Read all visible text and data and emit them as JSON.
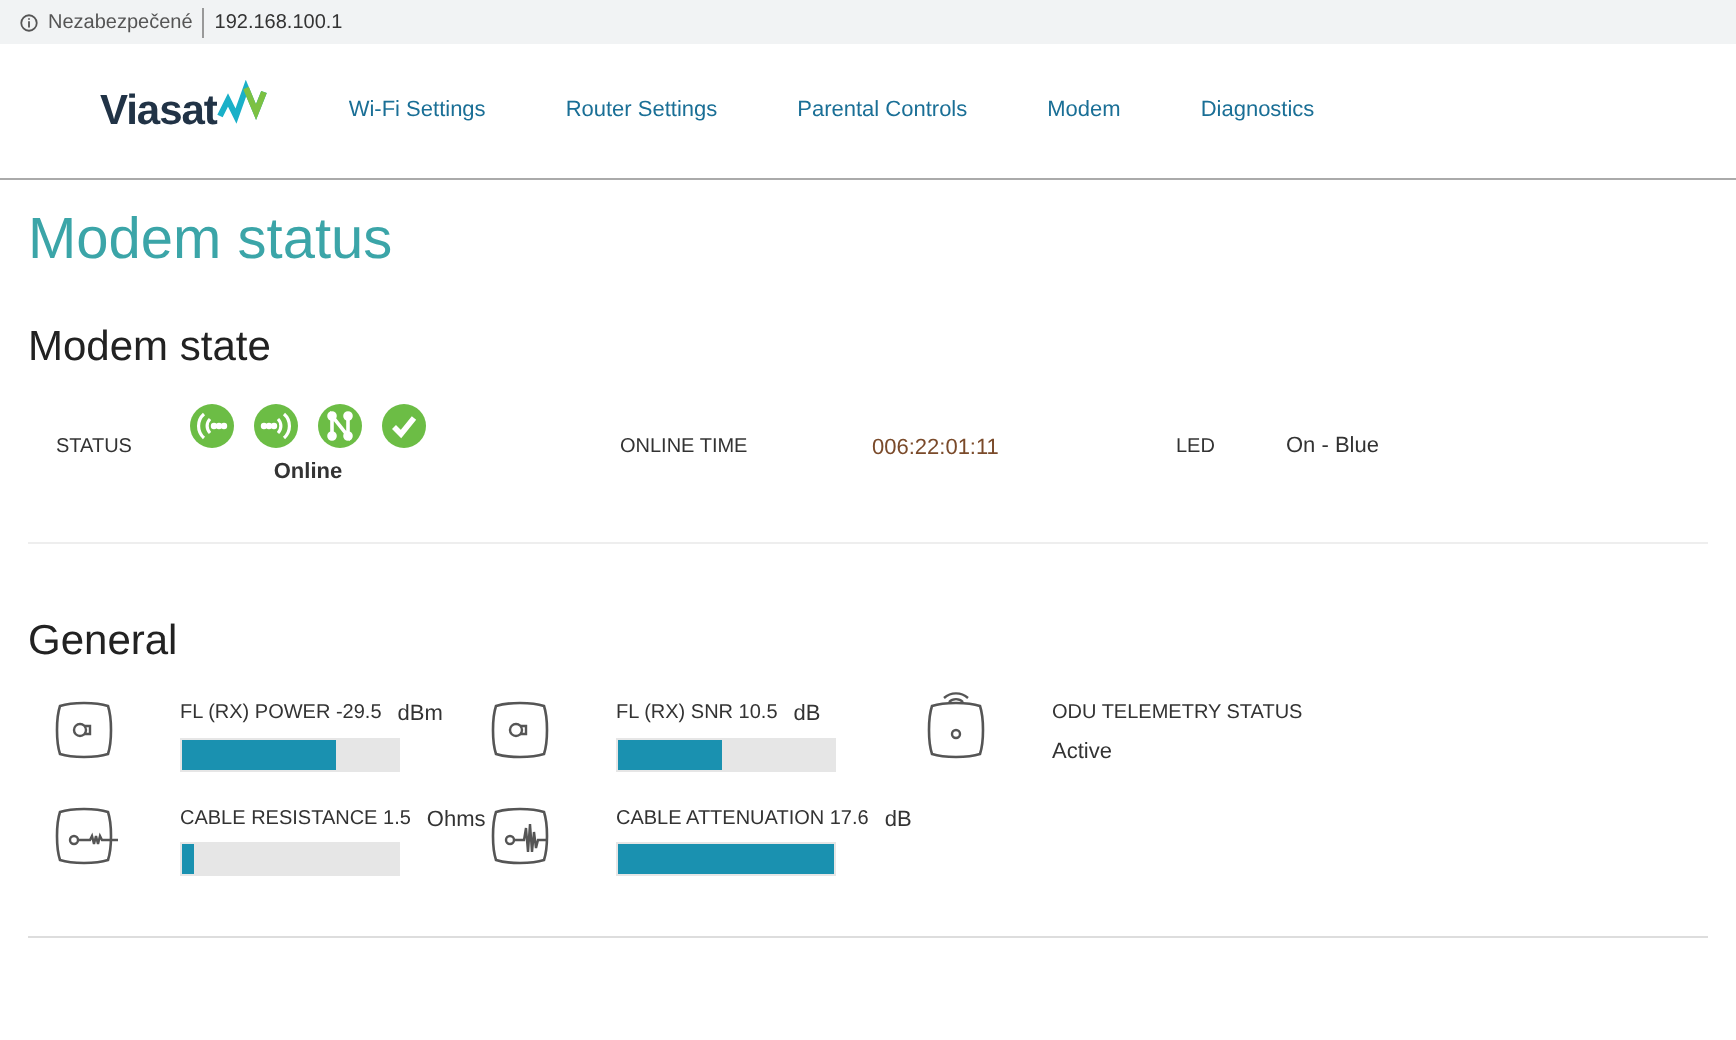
{
  "address_bar": {
    "security": "Nezabezpečené",
    "url": "192.168.100.1"
  },
  "header": {
    "logo": "Viasat",
    "nav": [
      "Wi-Fi Settings",
      "Router Settings",
      "Parental Controls",
      "Modem",
      "Diagnostics"
    ]
  },
  "page_title": "Modem status",
  "modem_state": {
    "heading": "Modem state",
    "status_label": "STATUS",
    "status_icons": [
      {
        "kind": "receive"
      },
      {
        "kind": "transmit"
      },
      {
        "kind": "network"
      },
      {
        "kind": "check"
      }
    ],
    "status_value": "Online",
    "online_time_label": "ONLINE TIME",
    "online_time": "006:22:01:11",
    "led_label": "LED",
    "led_value": "On - Blue"
  },
  "general": {
    "heading": "General",
    "metrics": [
      {
        "kind": "signal",
        "label": "FL (RX) POWER -29.5",
        "unit": "dBm",
        "level": 0.71
      },
      {
        "kind": "signal",
        "label": "FL (RX) SNR 10.5",
        "unit": "dB",
        "level": 0.48
      },
      {
        "kind": "telemetry",
        "label": "ODU TELEMETRY STATUS",
        "value": "Active"
      },
      {
        "kind": "cable",
        "label": "CABLE RESISTANCE 1.5",
        "unit": "Ohms",
        "level": 0.06
      },
      {
        "kind": "cable",
        "label": "CABLE ATTENUATION 17.6",
        "unit": "dB",
        "level": 1.0
      }
    ]
  }
}
